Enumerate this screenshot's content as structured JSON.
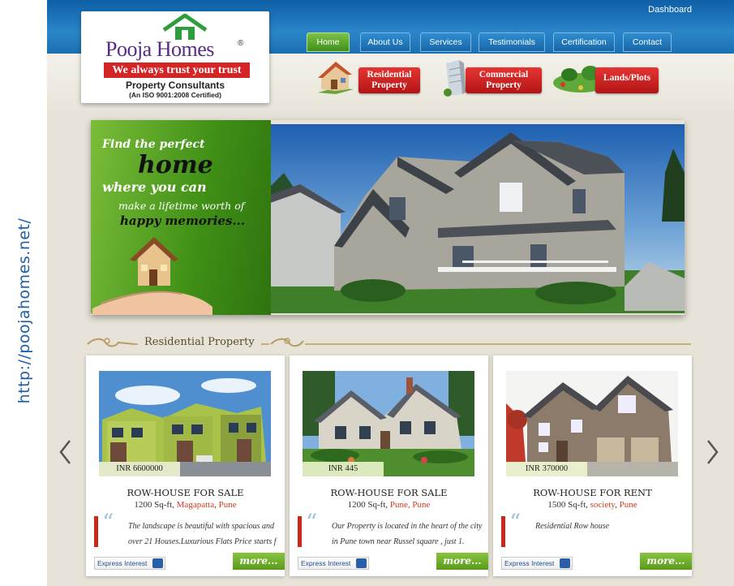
{
  "side_url": "http://poojahomes.net/",
  "top": {
    "dashboard": "Dashboard"
  },
  "logo": {
    "name_part1": "Pooja",
    "name_part2": "Homes",
    "reg": "®",
    "tagline": "We always trust your trust",
    "subtitle": "Property Consultants",
    "iso": "(An ISO 9001:2008 Certified)"
  },
  "nav": [
    {
      "label": "Home",
      "active": true
    },
    {
      "label": "About Us"
    },
    {
      "label": "Services"
    },
    {
      "label": "Testimonials"
    },
    {
      "label": "Certification"
    },
    {
      "label": "Contact"
    }
  ],
  "categories": [
    {
      "line1": "Residential",
      "line2": "Property"
    },
    {
      "line1": "Commercial",
      "line2": "Property"
    },
    {
      "line1": "Lands/Plots",
      "line2": ""
    }
  ],
  "hero": {
    "line1": "Find the perfect",
    "line2": "home",
    "line3": "where you can",
    "line4": "make a lifetime worth of",
    "line5": "happy memories..."
  },
  "section": {
    "title": "Residential Property"
  },
  "listings": [
    {
      "price": "INR 6600000",
      "title": "ROW-HOUSE FOR SALE",
      "area": "1200 Sq-ft, ",
      "locality": "Magapatta",
      "sep": ", ",
      "city": "Pune",
      "description": "The landscape is beautiful with spacious and over 21 Houses.Luxurious Flats Price starts f",
      "express": "Express Interest",
      "more": "more..."
    },
    {
      "price": "INR 445",
      "title": "ROW-HOUSE FOR SALE",
      "area": "1200 Sq-ft, ",
      "locality": "Pune",
      "sep": ", ",
      "city": "Pune",
      "description": "Our Property is located in the heart of the city in Pune town near Russel square , just 1.",
      "express": "Express Interest",
      "more": "more..."
    },
    {
      "price": "INR 370000",
      "title": "ROW-HOUSE FOR RENT",
      "area": "1500 Sq-ft, ",
      "locality": "society",
      "sep": ", ",
      "city": "Pune",
      "description": "Residential Row house",
      "express": "Express Interest",
      "more": "more..."
    }
  ],
  "colors": {
    "nav_blue": "#1766a8",
    "accent_red": "#d32426",
    "accent_green": "#5a9a1c",
    "brand_purple": "#5a2a86"
  }
}
